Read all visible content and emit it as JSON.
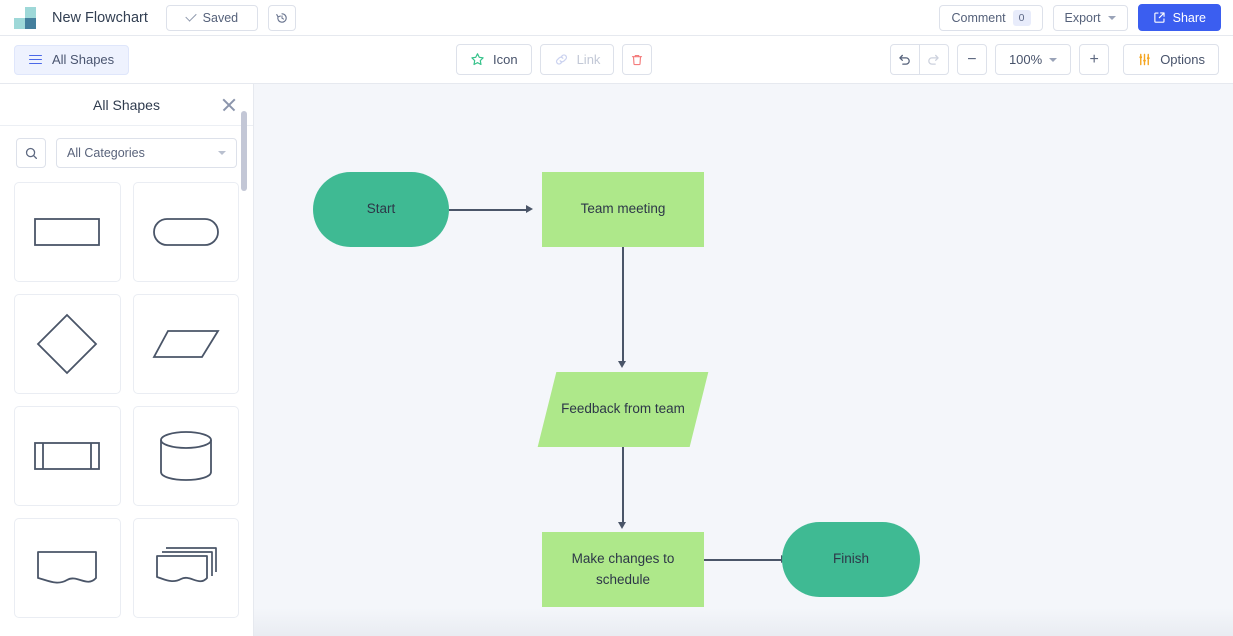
{
  "header": {
    "logo_name": "app-logo",
    "doc_title": "New Flowchart",
    "saved_label": "Saved",
    "history_icon": "history-clock-icon",
    "comment_label": "Comment",
    "comment_count": "0",
    "export_label": "Export",
    "share_label": "Share",
    "share_icon": "external-link-icon",
    "accent_color": "#3b5ef0"
  },
  "toolbar": {
    "all_shapes_label": "All Shapes",
    "icon_label": "Icon",
    "icon_glyph": "star-icon",
    "link_label": "Link",
    "link_glyph": "link-chain-icon",
    "delete_glyph": "trash-icon",
    "undo_glyph": "undo-icon",
    "redo_glyph": "redo-icon",
    "zoom_out_label": "−",
    "zoom_level": "100%",
    "zoom_in_label": "+",
    "options_label": "Options",
    "options_glyph": "sliders-icon",
    "star_color": "#35c28a",
    "trash_color": "#f47c7c",
    "options_color": "#f5a623"
  },
  "sidebar": {
    "title": "All Shapes",
    "close_icon": "close-icon",
    "search_icon": "search-icon",
    "search_placeholder": "",
    "category_value": "All Categories",
    "shapes": [
      {
        "name": "rectangle",
        "label": "Rectangle"
      },
      {
        "name": "rounded-rectangle",
        "label": "Rounded Rectangle"
      },
      {
        "name": "diamond",
        "label": "Diamond"
      },
      {
        "name": "parallelogram",
        "label": "Parallelogram"
      },
      {
        "name": "predefined-process",
        "label": "Predefined Process"
      },
      {
        "name": "cylinder",
        "label": "Cylinder"
      },
      {
        "name": "document",
        "label": "Document"
      },
      {
        "name": "multi-document",
        "label": "Multi Document"
      }
    ]
  },
  "canvas": {
    "background": "#f4f6fa",
    "nodes": [
      {
        "id": "start",
        "label": "Start",
        "shape": "stadium",
        "color": "#3fba93"
      },
      {
        "id": "team-meeting",
        "label": "Team meeting",
        "shape": "rectangle",
        "color": "#aee88a"
      },
      {
        "id": "feedback",
        "label": "Feedback from team",
        "shape": "parallelogram",
        "color": "#aee88a"
      },
      {
        "id": "make-changes",
        "label": "Make changes to schedule",
        "shape": "rectangle",
        "color": "#aee88a"
      },
      {
        "id": "finish",
        "label": "Finish",
        "shape": "stadium",
        "color": "#3fba93"
      }
    ],
    "edges": [
      {
        "from": "start",
        "to": "team-meeting",
        "direction": "right"
      },
      {
        "from": "team-meeting",
        "to": "feedback",
        "direction": "down"
      },
      {
        "from": "feedback",
        "to": "make-changes",
        "direction": "down"
      },
      {
        "from": "make-changes",
        "to": "finish",
        "direction": "right"
      }
    ]
  }
}
